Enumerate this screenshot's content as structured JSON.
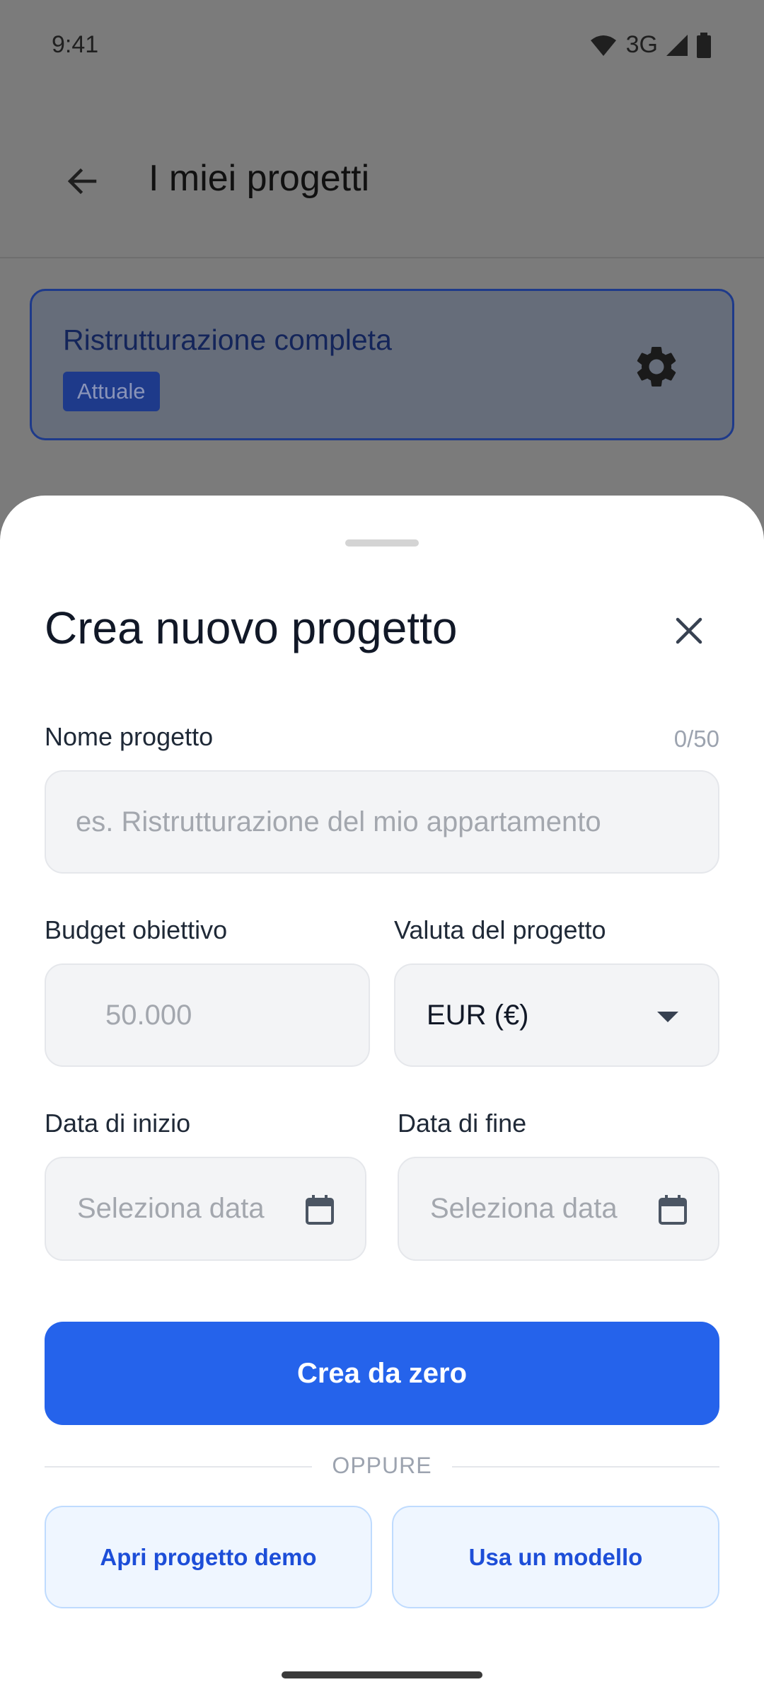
{
  "status_bar": {
    "time": "9:41",
    "network": "3G"
  },
  "app_bar": {
    "title": "I miei progetti"
  },
  "current_project": {
    "name": "Ristrutturazione completa",
    "badge": "Attuale"
  },
  "sheet": {
    "title": "Crea nuovo progetto",
    "name_field": {
      "label": "Nome progetto",
      "counter": "0/50",
      "value": "",
      "placeholder": "es. Ristrutturazione del mio appartamento"
    },
    "budget_field": {
      "label": "Budget obiettivo",
      "value": "",
      "placeholder": "50.000"
    },
    "currency_field": {
      "label": "Valuta del progetto",
      "selected": "EUR (€)"
    },
    "start_date_field": {
      "label": "Data di inizio",
      "placeholder": "Seleziona data"
    },
    "end_date_field": {
      "label": "Data di fine",
      "placeholder": "Seleziona data"
    },
    "create_button": "Crea da zero",
    "divider_text": "OPPURE",
    "demo_button": "Apri progetto demo",
    "template_button": "Usa un modello"
  },
  "colors": {
    "primary": "#2563eb",
    "badge": "#1e3a8a",
    "secondary_bg": "#eff6ff",
    "secondary_text": "#1d4ed8"
  }
}
